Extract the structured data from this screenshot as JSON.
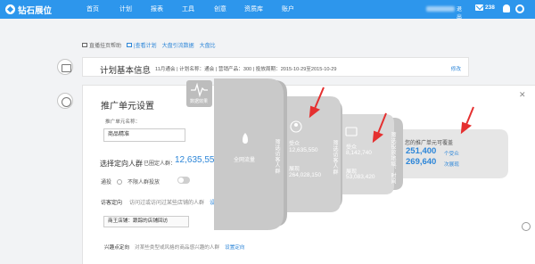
{
  "nav": {
    "logo": "钻石展位",
    "items": [
      "首页",
      "计划",
      "报表",
      "工具",
      "创意",
      "资质库",
      "账户"
    ],
    "logout": "退出",
    "message_count": "238"
  },
  "tabs": [
    {
      "label": "直播挂页帮助",
      "active": false
    },
    {
      "label": "|查看计划",
      "active": true
    },
    {
      "label": "大盘引流数据",
      "active": true
    },
    {
      "label": "大盘比",
      "active": true
    }
  ],
  "plan": {
    "title": "计划基本信息",
    "meta": "11月通会 | 计划名称：通会 | 营销产品：300 | 投放周期：2015-10-29至2015-10-29",
    "edit": "修改"
  },
  "unit": {
    "title": "推广单元设置",
    "name_label": "推广单元名称：",
    "name_value": "商品精准",
    "target_label": "选择定向人群",
    "target_count_label": "已圈定人群：",
    "target_count": "12,635,550",
    "general_label": "通投",
    "general_option": "不限人群投放",
    "shop_label": "访客定向",
    "shop_desc": "访问过或访问过某些店铺的人群",
    "shop_link": "设置定向",
    "shop_button": "商王店铺：跟踪的店铺回访",
    "interest_label": "兴趣点定向",
    "interest_desc": "对某些类型或风格的商品感兴趣的人群",
    "interest_link": "设置定向"
  },
  "funnel": {
    "badge": "数据效果",
    "stage1": {
      "label": "全网流量",
      "side": "筛选访客人群"
    },
    "stage2": {
      "side": "筛选访客人群",
      "visitors_label": "受众",
      "visitors": "12,635,550",
      "impressions_label": "展现",
      "impressions": "264,028,150"
    },
    "stage3": {
      "side": "筛选投放时间、地域",
      "visitors_label": "受众",
      "visitors": "8,142,740",
      "impressions_label": "展现",
      "impressions": "53,083,420"
    },
    "stage4": {
      "side": "筛选投放地域、时间",
      "title": "您的推广单元可覆盖",
      "visitors": "251,400",
      "visitors_unit": "个受众",
      "impressions": "269,640",
      "impressions_unit": "次展现"
    }
  },
  "colors": {
    "nav_bg": "#2d96ec",
    "accent": "#2d86d8",
    "funnel_gray": "#c9c9c9",
    "arrow_red": "#e53030"
  }
}
